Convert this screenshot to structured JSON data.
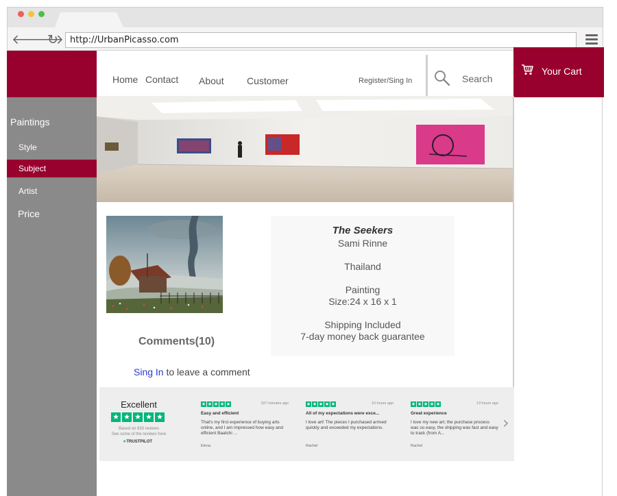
{
  "browser": {
    "url": "http://UrbanPicasso.com",
    "back_glyph": "🡐",
    "forward_glyph": "🡒",
    "reload_glyph": "↻"
  },
  "nav": {
    "home": "Home",
    "contact": "Contact",
    "about": "About",
    "customer": "Customer",
    "register": "Register/Sing In"
  },
  "search": {
    "label": "Search"
  },
  "cart": {
    "label": "Your Cart"
  },
  "sidebar": {
    "paintings": "Paintings",
    "style": "Style",
    "subject": "Subject",
    "artist": "Artist",
    "price": "Price",
    "selected": "Subject"
  },
  "product": {
    "title": "The Seekers",
    "artist": "Sami Rinne",
    "country": "Thailand",
    "medium": "Painting",
    "size": "Size:24 x 16 x 1",
    "shipping": "Shipping Included",
    "guarantee": "7-day money back guarantee"
  },
  "comments": {
    "title": "Comments(10)",
    "signin_link": "Sing In",
    "signin_rest": " to leave a comment"
  },
  "trustpilot": {
    "rating_word": "Excellent",
    "based_on": "Based on 833 reviews",
    "see_some": "See some of the reviews here",
    "logo": "TRUSTPILOT",
    "reviews": [
      {
        "time": "107 minutes ago",
        "title": "Easy and efficient",
        "body": "That's my first experience of buying arts online, and I am impressed how easy and efficient Baatchi ...",
        "name": "Elena"
      },
      {
        "time": "10 hours ago",
        "title": "All of my expectations were exce...",
        "body": "I love art! The pieces I purchased arrived quickly and exceeded my expectations.",
        "name": "Rachel"
      },
      {
        "time": "13 hours ago",
        "title": "Great experience",
        "body": "I love my new art; the purchase process was so easy, the shipping was fast and easy to track (from A...",
        "name": "Rachel"
      }
    ]
  },
  "colors": {
    "brand": "#98002e",
    "sidebar": "#8a8a8a",
    "trustpilot_green": "#00b67a"
  }
}
